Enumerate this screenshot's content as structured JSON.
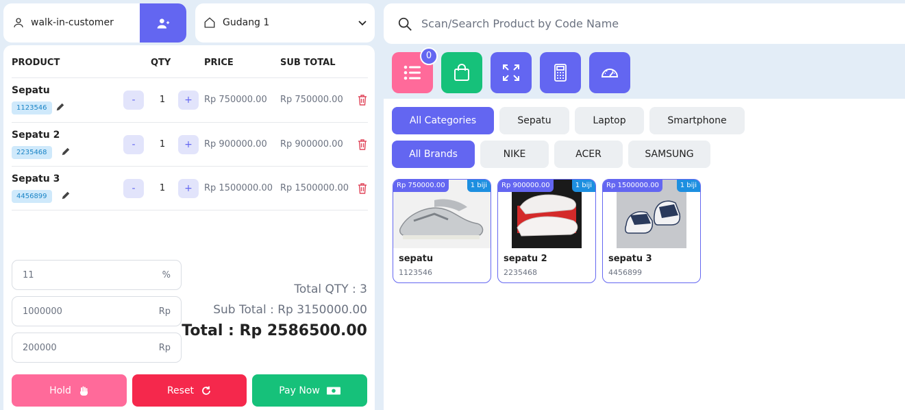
{
  "customer": {
    "name": "walk-in-customer",
    "icon": "user-icon",
    "add_icon": "user-plus-icon"
  },
  "warehouse": {
    "name": "Gudang 1",
    "icon": "home-icon"
  },
  "cart": {
    "columns": {
      "product": "PRODUCT",
      "qty": "QTY",
      "price": "PRICE",
      "subtotal": "SUB TOTAL"
    },
    "items": [
      {
        "name": "Sepatu",
        "code": "1123546",
        "qty": "1",
        "price": "Rp 750000.00",
        "subtotal": "Rp 750000.00"
      },
      {
        "name": "Sepatu 2",
        "code": "2235468",
        "qty": "1",
        "price": "Rp 900000.00",
        "subtotal": "Rp 900000.00"
      },
      {
        "name": "Sepatu 3",
        "code": "4456899",
        "qty": "1",
        "price": "Rp 1500000.00",
        "subtotal": "Rp 1500000.00"
      }
    ],
    "minus": "-",
    "plus": "+"
  },
  "inputs": {
    "tax": {
      "value": "11",
      "unit": "%"
    },
    "discount": {
      "value": "1000000",
      "unit": "Rp"
    },
    "shipping": {
      "value": "200000",
      "unit": "Rp"
    }
  },
  "totals": {
    "qty": "Total QTY : 3",
    "subtotal": "Sub Total : Rp 3150000.00",
    "total": "Total : Rp 2586500.00"
  },
  "actions": {
    "hold": "Hold",
    "reset": "Reset",
    "pay": "Pay Now"
  },
  "search": {
    "placeholder": "Scan/Search Product by Code Name"
  },
  "toolbar": {
    "list_count": "0"
  },
  "categories": [
    "All Categories",
    "Sepatu",
    "Laptop",
    "Smartphone"
  ],
  "brands": [
    "All Brands",
    "NIKE",
    "ACER",
    "SAMSUNG"
  ],
  "products": [
    {
      "name": "sepatu",
      "code": "1123546",
      "price": "Rp 750000.00",
      "stock": "1 biji"
    },
    {
      "name": "sepatu 2",
      "code": "2235468",
      "price": "Rp 900000.00",
      "stock": "1 biji"
    },
    {
      "name": "sepatu 3",
      "code": "4456899",
      "price": "Rp 1500000.00",
      "stock": "1 biji"
    }
  ],
  "colors": {
    "accent": "#6366f1",
    "pink": "#ff6a9a",
    "red": "#f5284c",
    "green": "#16c17a",
    "badge": "#1d8fe0"
  }
}
